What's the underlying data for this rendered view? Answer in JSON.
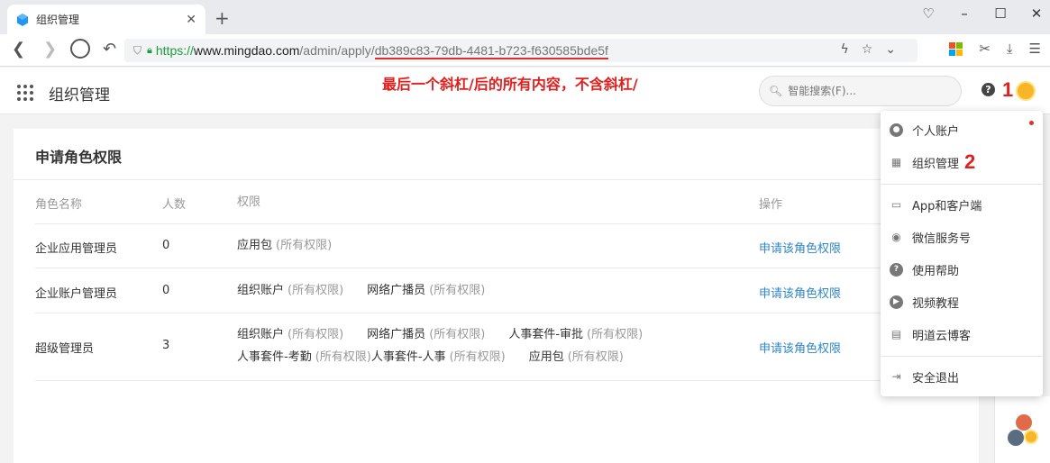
{
  "browser": {
    "tab_title": "组织管理",
    "url": {
      "scheme": "https://",
      "host": "www.mingdao.com",
      "path": "/admin/apply/",
      "id": "db389c83-79db-4481-b723-f630585bde5f"
    }
  },
  "header": {
    "app_title": "组织管理",
    "annotation": "最后一个斜杠/后的所有内容，不含斜杠/",
    "search_placeholder": "智能搜索(F)...",
    "marker_1": "1",
    "marker_2": "2"
  },
  "card": {
    "title": "申请角色权限",
    "columns": [
      "角色名称",
      "人数",
      "权限",
      "操作"
    ],
    "rows": [
      {
        "name": "企业应用管理员",
        "count": "0",
        "permissions": [
          {
            "name": "应用包",
            "scope": "(所有权限)"
          }
        ],
        "action": "申请该角色权限"
      },
      {
        "name": "企业账户管理员",
        "count": "0",
        "permissions": [
          {
            "name": "组织账户",
            "scope": "(所有权限)"
          },
          {
            "name": "网络广播员",
            "scope": "(所有权限)"
          }
        ],
        "action": "申请该角色权限"
      },
      {
        "name": "超级管理员",
        "count": "3",
        "permissions": [
          {
            "name": "组织账户",
            "scope": "(所有权限)"
          },
          {
            "name": "网络广播员",
            "scope": "(所有权限)"
          },
          {
            "name": "人事套件-审批",
            "scope": "(所有权限)"
          },
          {
            "name": "人事套件-考勤",
            "scope": "(所有权限)"
          },
          {
            "name": "人事套件-人事",
            "scope": "(所有权限)"
          },
          {
            "name": "应用包",
            "scope": "(所有权限)"
          }
        ],
        "action": "申请该角色权限"
      }
    ]
  },
  "menu": {
    "items": [
      {
        "label": "个人账户",
        "icon": "user-circle-icon"
      },
      {
        "label": "组织管理",
        "icon": "building-icon"
      },
      {
        "label": "App和客户端",
        "icon": "devices-icon"
      },
      {
        "label": "微信服务号",
        "icon": "wechat-icon"
      },
      {
        "label": "使用帮助",
        "icon": "help-circle-icon"
      },
      {
        "label": "视频教程",
        "icon": "play-circle-icon"
      },
      {
        "label": "明道云博客",
        "icon": "blog-icon"
      },
      {
        "label": "安全退出",
        "icon": "logout-icon"
      }
    ]
  }
}
